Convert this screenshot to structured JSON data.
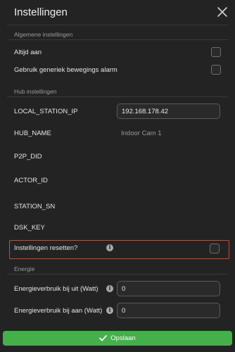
{
  "header": {
    "title": "Instellingen"
  },
  "sections": {
    "general": "Algemene instellingen",
    "hub": "Hub instellingen",
    "energy": "Energie"
  },
  "general": {
    "always_on": "Altijd aan",
    "generic_motion": "Gebruik generiek bewegings alarm"
  },
  "hub": {
    "local_station_ip_label": "LOCAL_STATION_IP",
    "local_station_ip_value": "192.168.178.42",
    "hub_name_label": "HUB_NAME",
    "hub_name_value": "Indoor Cam 1",
    "p2p_did_label": "P2P_DID",
    "actor_id_label": "ACTOR_ID",
    "station_sn_label": "STATION_SN",
    "dsk_key_label": "DSK_KEY",
    "reset_label": "Instellingen resetten?"
  },
  "energy": {
    "off_label": "Energieverbruik bij uit (Watt)",
    "off_value": "0",
    "on_label": "Energieverbruik bij aan (Watt)",
    "on_value": "0"
  },
  "footer": {
    "save_label": "Opslaan"
  },
  "colors": {
    "accent": "#43b049",
    "highlight": "#d9452a",
    "background": "#232323"
  }
}
